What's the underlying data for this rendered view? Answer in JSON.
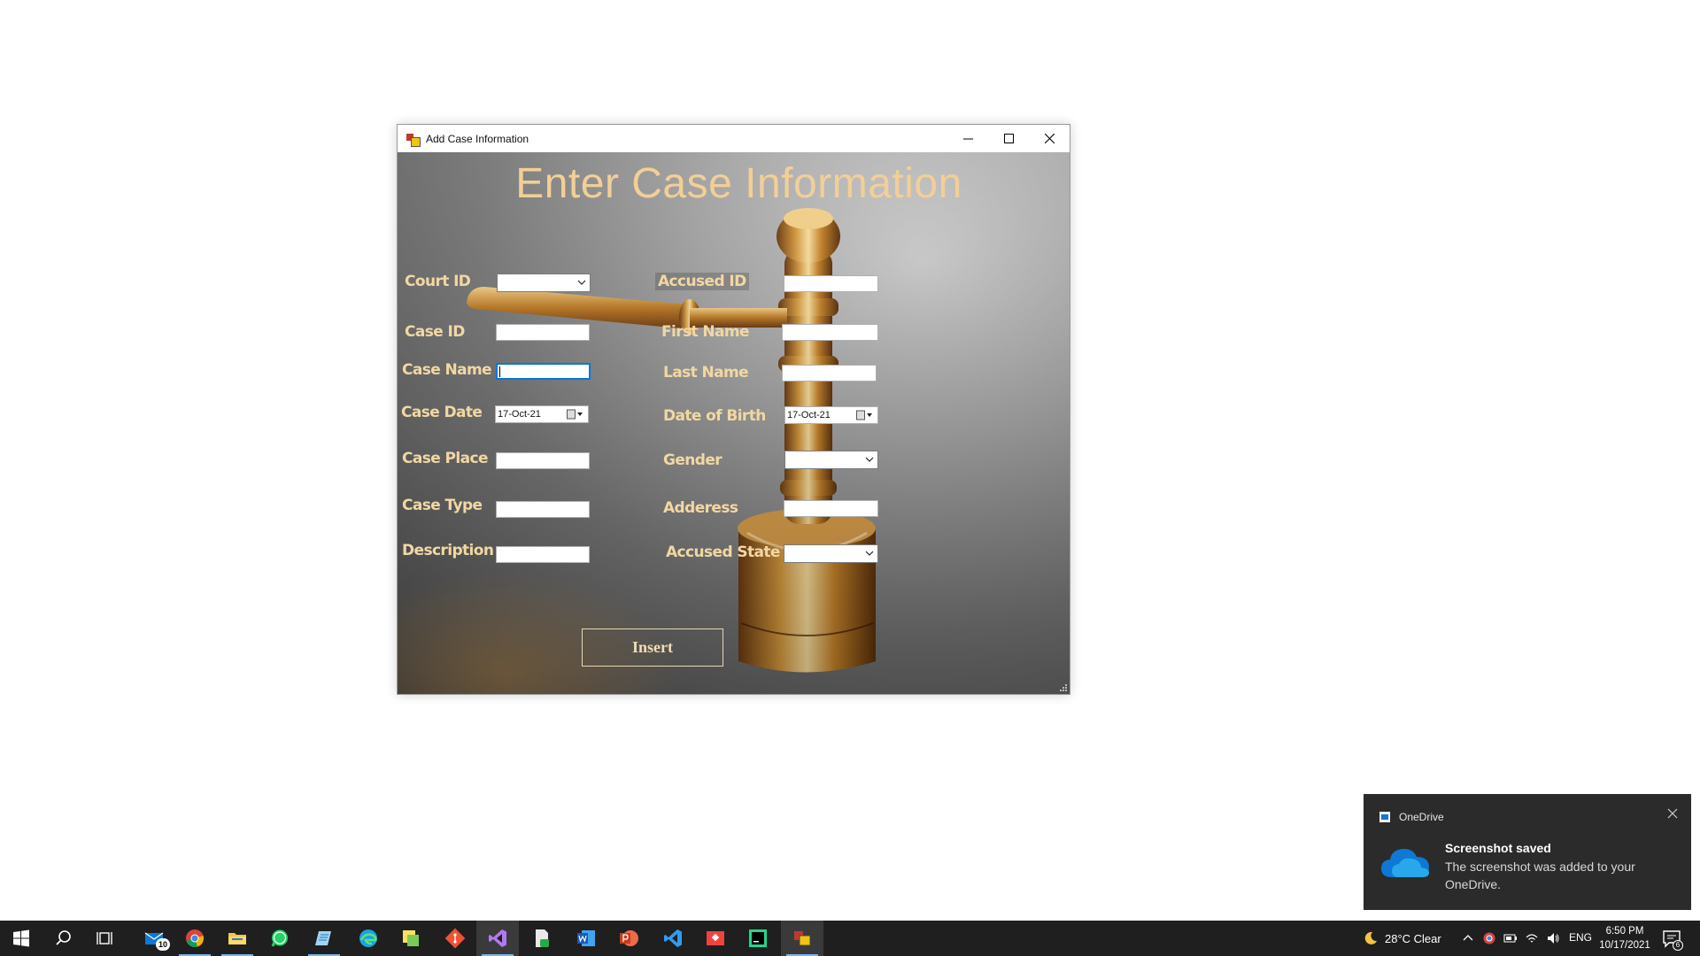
{
  "window": {
    "title": "Add Case Information",
    "heading": "Enter Case Information"
  },
  "form": {
    "court_id_label": "Court ID",
    "case_id_label": "Case ID",
    "case_name_label": "Case Name",
    "case_date_label": "Case Date",
    "case_date_value": "17-Oct-21",
    "case_place_label": "Case Place",
    "case_type_label": "Case Type",
    "description_label": "Description",
    "accused_id_label": "Accused ID",
    "first_name_label": "First Name",
    "last_name_label": "Last Name",
    "dob_label": "Date of Birth",
    "dob_value": "17-Oct-21",
    "gender_label": "Gender",
    "address_label": "Adderess",
    "accused_state_label": "Accused State",
    "insert_label": "Insert"
  },
  "toast": {
    "app": "OneDrive",
    "heading": "Screenshot saved",
    "body": "The screenshot was added to your OneDrive."
  },
  "taskbar": {
    "mail_badge": "10",
    "weather": "28°C  Clear",
    "language": "ENG",
    "time": "6:50 PM",
    "date": "10/17/2021",
    "notification_count": "6"
  },
  "colors": {
    "label": "#f2d7a3",
    "heading": "#f2cf97",
    "taskbar": "#1f1f1f",
    "toast": "#2b2b2b",
    "onedrive": "#0f78d4"
  }
}
